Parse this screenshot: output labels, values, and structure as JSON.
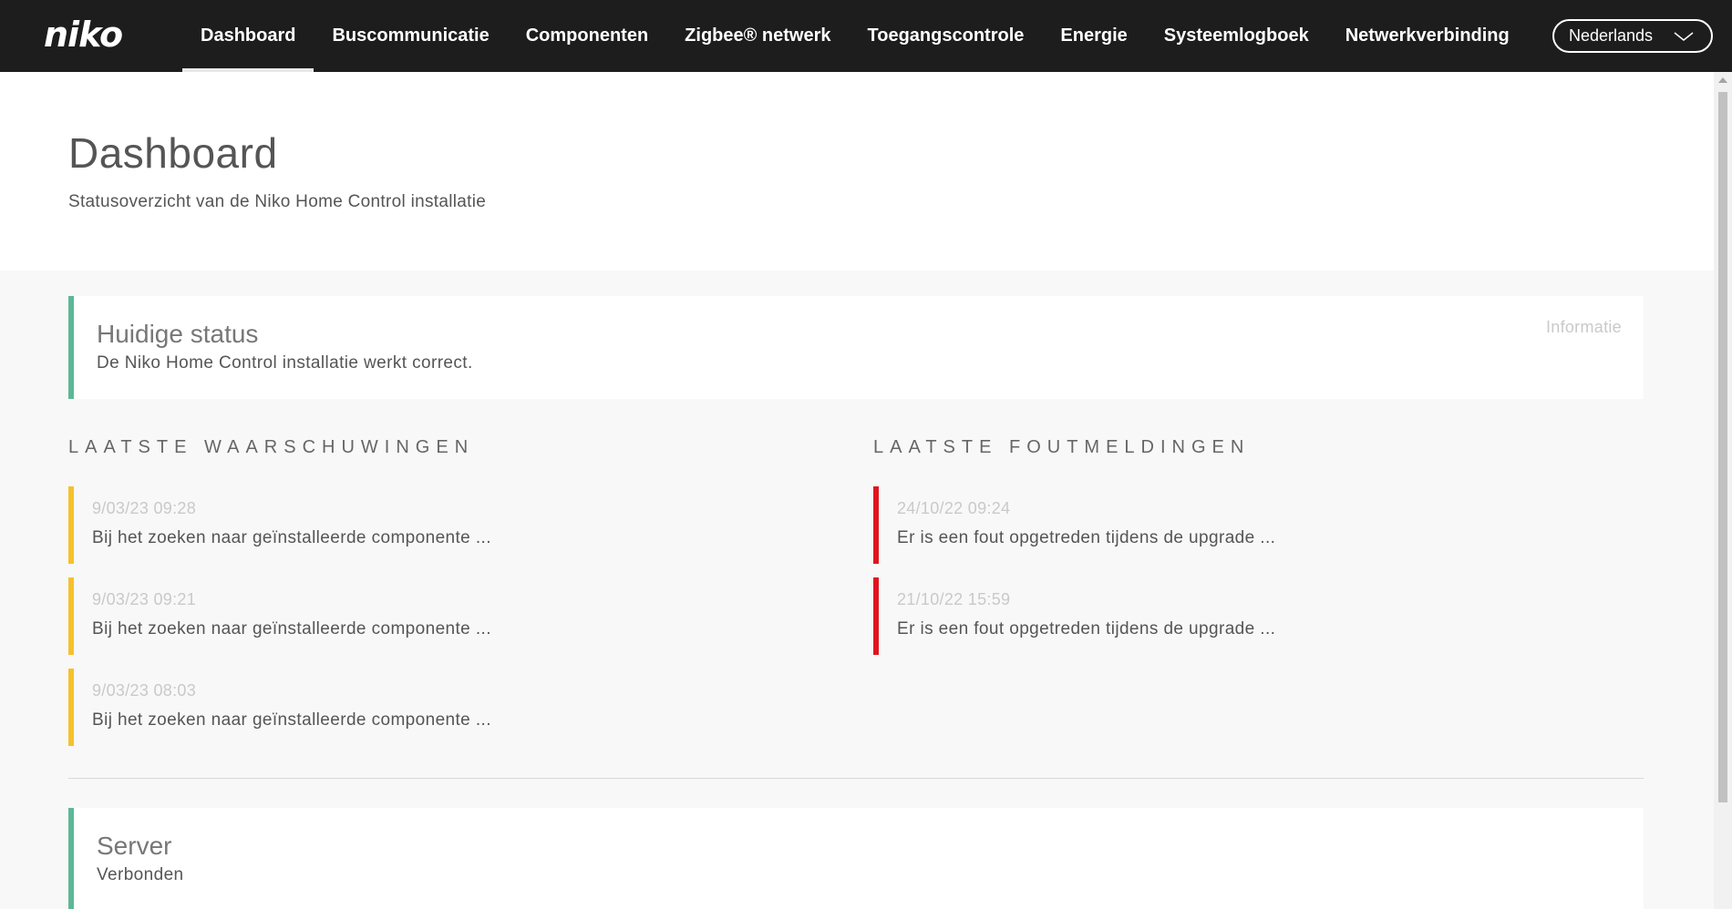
{
  "brand": {
    "logo": "niko"
  },
  "nav": {
    "items": [
      {
        "label": "Dashboard"
      },
      {
        "label": "Buscommunicatie"
      },
      {
        "label": "Componenten"
      },
      {
        "label": "Zigbee® netwerk"
      },
      {
        "label": "Toegangscontrole"
      },
      {
        "label": "Energie"
      },
      {
        "label": "Systeemlogboek"
      },
      {
        "label": "Netwerkverbinding"
      }
    ],
    "active_index": 0
  },
  "language": {
    "selected": "Nederlands",
    "icon": "chevron-down-icon"
  },
  "page": {
    "title": "Dashboard",
    "subtitle": "Statusoverzicht van de Niko Home Control installatie"
  },
  "status_card": {
    "title": "Huidige status",
    "text": "De Niko Home Control installatie werkt correct.",
    "info_link": "Informatie"
  },
  "warnings": {
    "title": "LAATSTE WAARSCHUWINGEN",
    "items": [
      {
        "date": "9/03/23 09:28",
        "text": "Bij het zoeken naar geïnstalleerde componente ..."
      },
      {
        "date": "9/03/23 09:21",
        "text": "Bij het zoeken naar geïnstalleerde componente ..."
      },
      {
        "date": "9/03/23 08:03",
        "text": "Bij het zoeken naar geïnstalleerde componente ..."
      }
    ]
  },
  "errors": {
    "title": "LAATSTE FOUTMELDINGEN",
    "items": [
      {
        "date": "24/10/22 09:24",
        "text": "Er is een fout opgetreden tijdens de upgrade ..."
      },
      {
        "date": "21/10/22 15:59",
        "text": "Er is een fout opgetreden tijdens de upgrade ..."
      }
    ]
  },
  "server_card": {
    "title": "Server",
    "text": "Verbonden"
  },
  "colors": {
    "topbar": "#1d1d1d",
    "ok_accent": "#5cb896",
    "warning_accent": "#f7c12c",
    "error_accent": "#e1141e"
  }
}
